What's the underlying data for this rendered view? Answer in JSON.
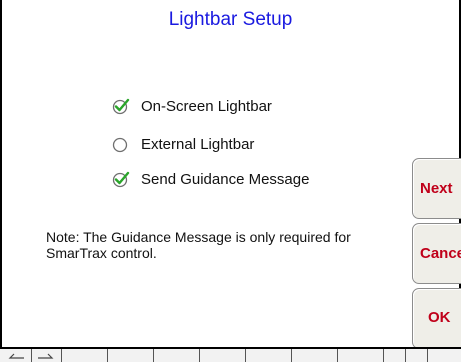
{
  "dialog": {
    "title": "Lightbar Setup",
    "options": [
      {
        "label": "On-Screen Lightbar",
        "checked": true
      },
      {
        "label": "External Lightbar",
        "checked": false
      },
      {
        "label": "Send Guidance Message",
        "checked": true
      }
    ],
    "note": "Note: The Guidance Message is only required for SmarTrax control."
  },
  "buttons": {
    "next": "Next",
    "cancel": "Cance",
    "ok": "OK"
  },
  "colors": {
    "title": "#1a1ae0",
    "button_text": "#c0001a",
    "check": "#2aa52a"
  }
}
